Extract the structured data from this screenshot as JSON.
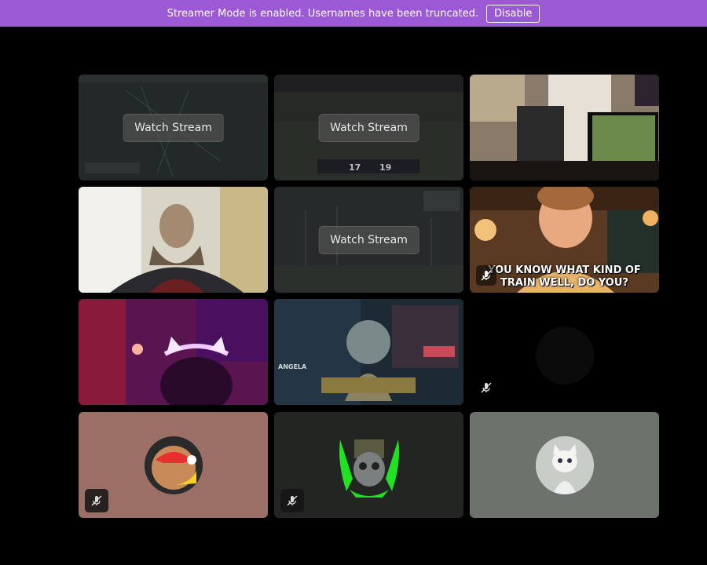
{
  "banner": {
    "message": "Streamer Mode is enabled. Usernames have been truncated.",
    "disable_label": "Disable"
  },
  "tiles": {
    "watch_label": "Watch Stream",
    "football_score_left": "17",
    "football_score_right": "19",
    "caption": "YOU KNOW WHAT KIND OF TRAIN WELL, DO YOU?",
    "game_user": "ANGELA"
  },
  "colors": {
    "banner": "#9b59d6",
    "selected_border": "#6fc27c",
    "background": "#000000"
  }
}
